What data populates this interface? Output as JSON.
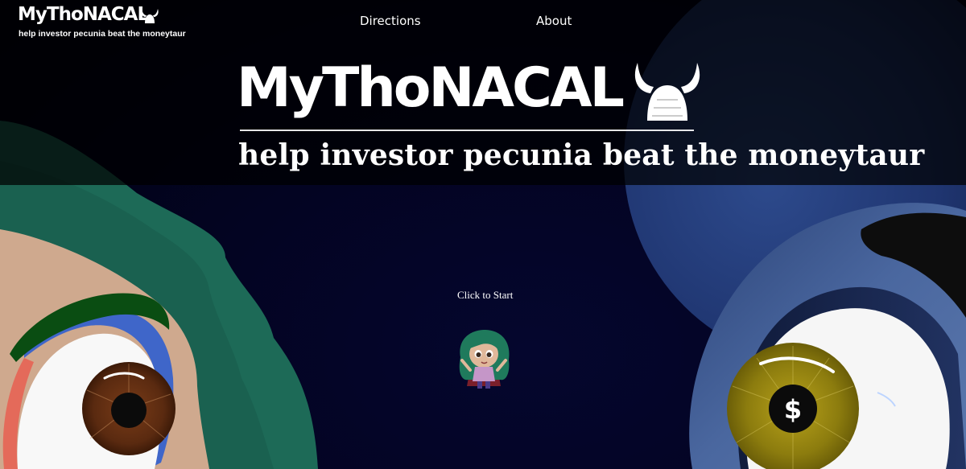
{
  "header": {
    "logo_word": "MyThoNACAL",
    "logo_tagline": "help investor pecunia beat the moneytaur"
  },
  "nav": {
    "items": [
      {
        "label": "Directions"
      },
      {
        "label": "About"
      }
    ]
  },
  "hero": {
    "title_word": "MyThoNACAL",
    "tagline": "help investor pecunia beat the moneytaur"
  },
  "start": {
    "label": "Click to Start"
  },
  "colors": {
    "hair_green": "#1e6a58",
    "skin": "#cfa98e",
    "eye_brown": "#5b2b12",
    "iris_gold": "#8a7a10",
    "taur_blue": "#3d5c97",
    "background": "#030422"
  },
  "icons": {
    "dollar_pupil": "$"
  }
}
